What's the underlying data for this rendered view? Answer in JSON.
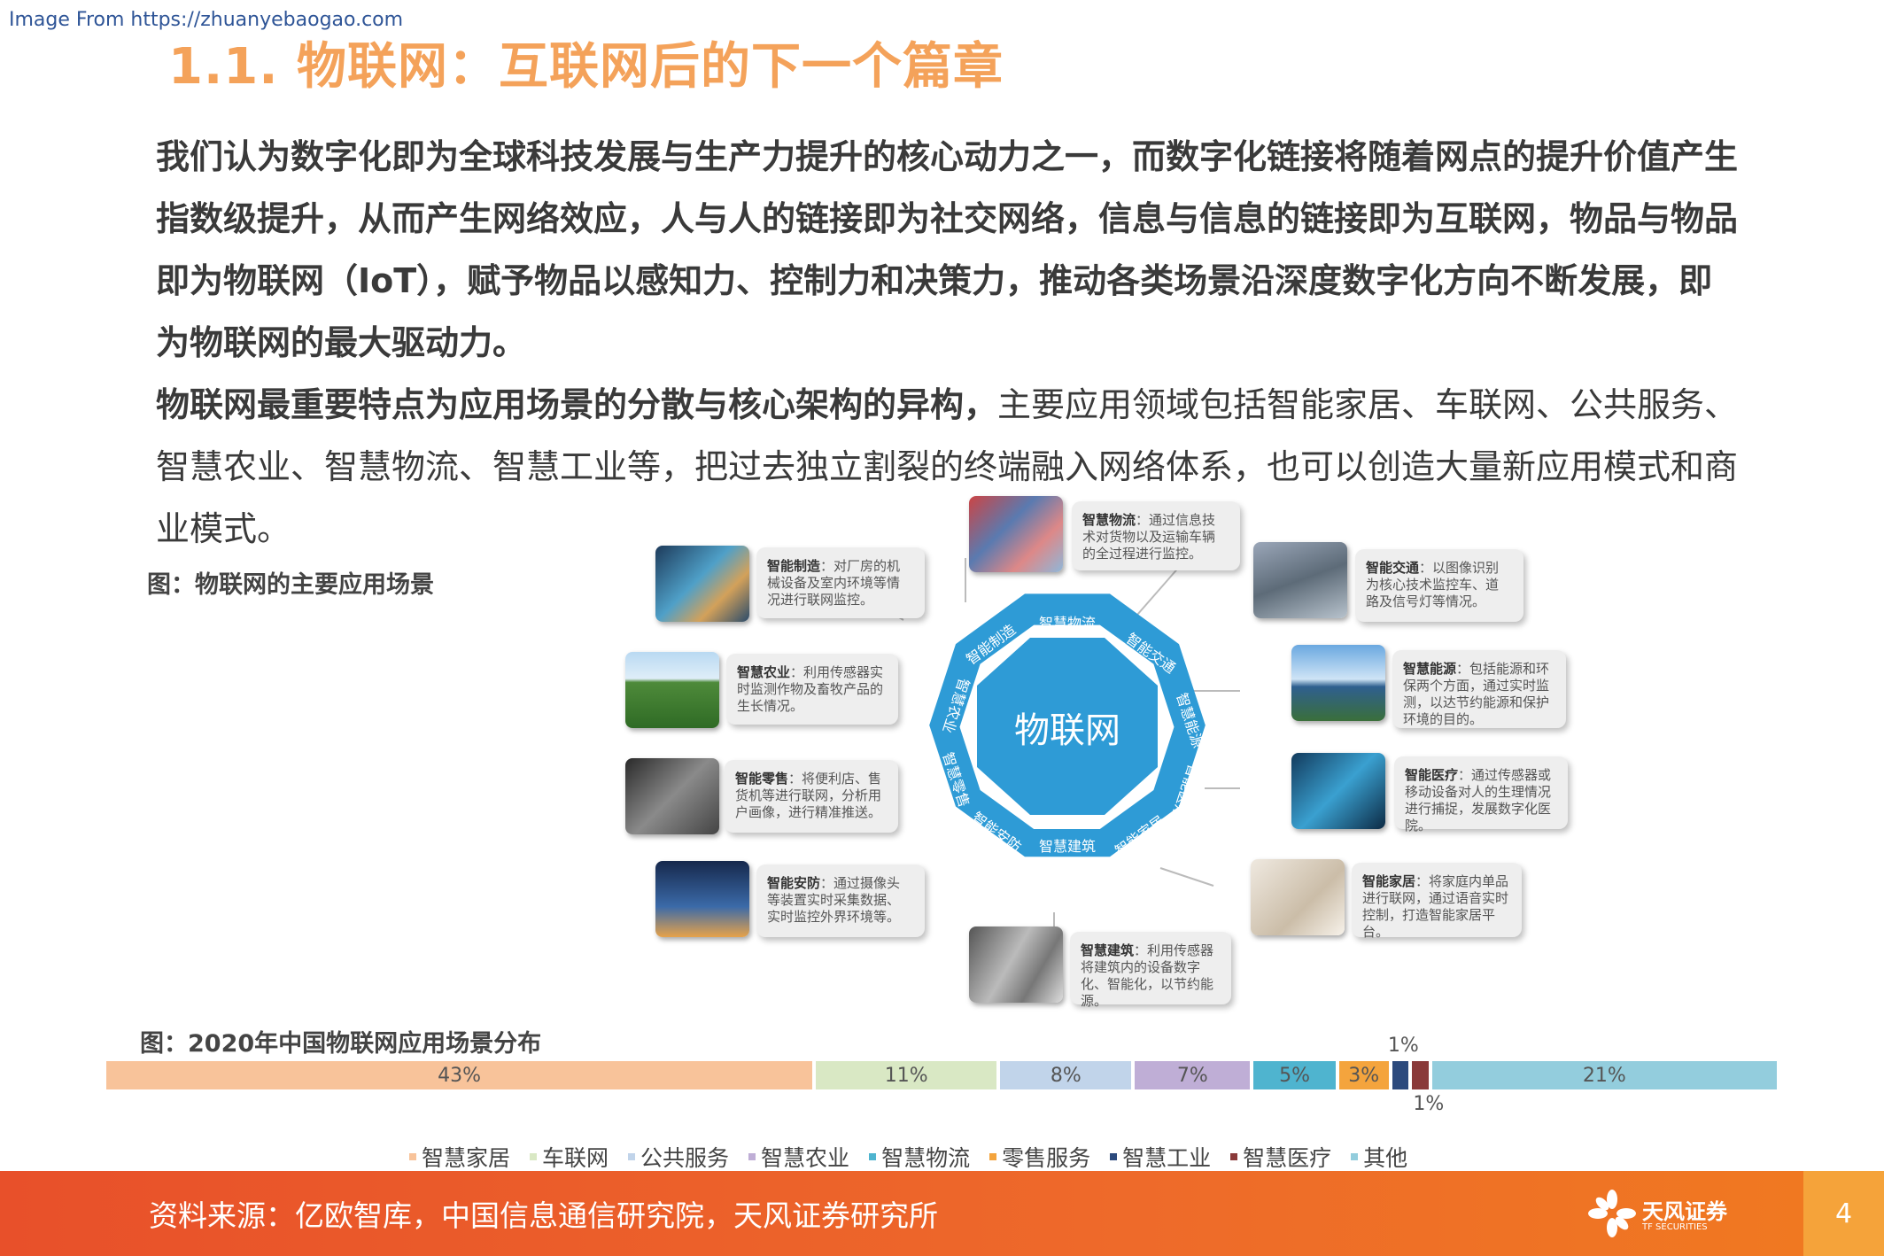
{
  "watermark": "Image From https://zhuanyebaogao.com",
  "title": "1.1. 物联网：互联网后的下一个篇章",
  "para1": "我们认为数字化即为全球科技发展与生产力提升的核心动力之一，而数字化链接将随着网点的提升价值产生指数级提升，从而产生网络效应，人与人的链接即为社交网络，信息与信息的链接即为互联网，物品与物品即为物联网（IoT），赋予物品以感知力、控制力和决策力，推动各类场景沿深度数字化方向不断发展，即为物联网的最大驱动力。",
  "para2_bold": "物联网最重要特点为应用场景的分散与核心架构的异构，",
  "para2_rest": "主要应用领域包括智能家居、车联网、公共服务、智慧农业、智慧物流、智慧工业等，把过去独立割裂的终端融入网络体系，也可以创造大量新应用模式和商业模式。",
  "fig1_label": "图：物联网的主要应用场景",
  "diagram": {
    "center": "物联网",
    "ring": [
      "智慧物流",
      "智能交通",
      "智慧能源",
      "智能医疗",
      "智能家居",
      "智慧建筑",
      "智能安防",
      "智慧零售",
      "智慧农业",
      "智能制造"
    ],
    "cards": {
      "wuliu": {
        "title": "智慧物流",
        "text": "：通过信息技术对货物以及运输车辆的全过程进行监控。"
      },
      "jiaotong": {
        "title": "智能交通",
        "text": "：以图像识别为核心技术监控车、道路及信号灯等情况。"
      },
      "nengyuan": {
        "title": "智慧能源",
        "text": "：包括能源和环保两个方面，通过实时监测，以达节约能源和保护环境的目的。"
      },
      "yiliao": {
        "title": "智能医疗",
        "text": "：通过传感器或移动设备对人的生理情况进行捕捉，发展数字化医院。"
      },
      "jiaju": {
        "title": "智能家居",
        "text": "：将家庭内单品进行联网，通过语音实时控制，打造智能家居平台。"
      },
      "jianzhu": {
        "title": "智慧建筑",
        "text": "：利用传感器将建筑内的设备数字化、智能化，以节约能源。"
      },
      "anfang": {
        "title": "智能安防",
        "text": "：通过摄像头等装置实时采集数据、实时监控外界环境等。"
      },
      "lingshou": {
        "title": "智能零售",
        "text": "：将便利店、售货机等进行联网，分析用户画像，进行精准推送。"
      },
      "nongye": {
        "title": "智慧农业",
        "text": "：利用传感器实时监测作物及畜牧产品的生长情况。"
      },
      "zhizao": {
        "title": "智能制造",
        "text": "：对厂房的机械设备及室内环境等情况进行联网监控。"
      }
    }
  },
  "fig2_label": "图：2020年中国物联网应用场景分布",
  "chart_data": {
    "type": "bar",
    "orientation": "horizontal-stacked-100",
    "categories": [
      "智慧家居",
      "车联网",
      "公共服务",
      "智慧农业",
      "智慧物流",
      "零售服务",
      "智慧工业",
      "智慧医疗",
      "其他"
    ],
    "values": [
      43,
      11,
      8,
      7,
      5,
      3,
      1,
      1,
      21
    ],
    "labels": [
      "43%",
      "11%",
      "8%",
      "7%",
      "5%",
      "3%",
      "1%",
      "1%",
      "21%"
    ],
    "colors": [
      "#f8c39a",
      "#d9e8c4",
      "#c1d4ea",
      "#bfaed6",
      "#4fb4cf",
      "#f4a43d",
      "#2c4a7d",
      "#8a3a3a",
      "#93cddd"
    ],
    "legend_position": "bottom"
  },
  "footer": {
    "source": "资料来源：亿欧智库，中国信息通信研究院，天风证券研究所",
    "logo_text": "天风证券",
    "logo_sub": "TF SECURITIES",
    "page": "4"
  }
}
